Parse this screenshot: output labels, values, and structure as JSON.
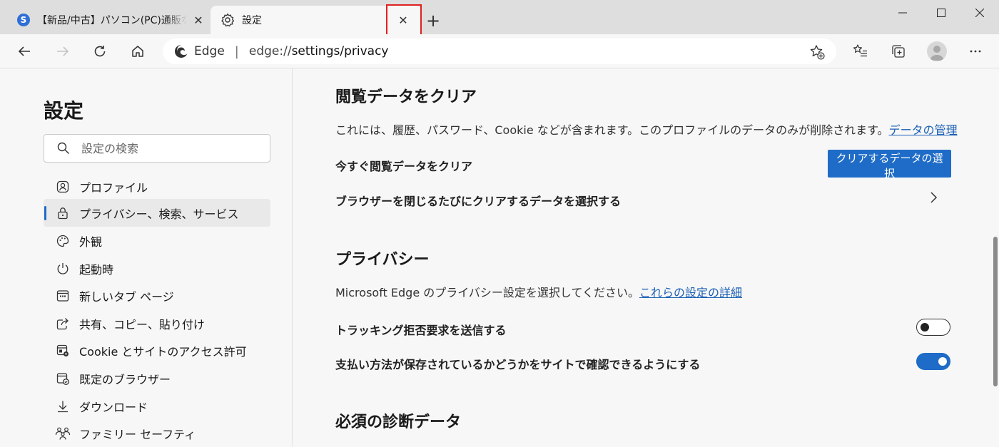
{
  "tabs": [
    {
      "title": "【新品/中古】パソコン(PC)通販ならソフマップ",
      "close": "✕"
    },
    {
      "title": "設定",
      "close": "✕"
    }
  ],
  "newtab": "+",
  "window_controls": {
    "minimize": "—",
    "maximize": "☐",
    "close": "✕"
  },
  "address": {
    "label": "Edge",
    "separator": "|",
    "url_prefix": "edge://",
    "url_rest": "settings/privacy"
  },
  "sidebar": {
    "title": "設定",
    "search_placeholder": "設定の検索",
    "items": [
      {
        "label": "プロファイル",
        "icon": "profile-icon"
      },
      {
        "label": "プライバシー、検索、サービス",
        "icon": "lock-icon",
        "active": true
      },
      {
        "label": "外観",
        "icon": "palette-icon"
      },
      {
        "label": "起動時",
        "icon": "power-icon"
      },
      {
        "label": "新しいタブ ページ",
        "icon": "newtab-page-icon"
      },
      {
        "label": "共有、コピー、貼り付け",
        "icon": "share-icon"
      },
      {
        "label": "Cookie とサイトのアクセス許可",
        "icon": "site-permissions-icon"
      },
      {
        "label": "既定のブラウザー",
        "icon": "default-browser-icon"
      },
      {
        "label": "ダウンロード",
        "icon": "download-icon"
      },
      {
        "label": "ファミリー セーフティ",
        "icon": "family-icon"
      }
    ]
  },
  "content": {
    "clear_section": {
      "title": "閲覧データをクリア",
      "description": "これには、履歴、パスワード、Cookie などが含まれます。このプロファイルのデータのみが削除されます。",
      "link": "データの管理",
      "clear_now_label": "今すぐ閲覧データをクリア",
      "clear_button": "クリアするデータの選択",
      "on_close_label": "ブラウザーを閉じるたびにクリアするデータを選択する"
    },
    "privacy_section": {
      "title": "プライバシー",
      "description": "Microsoft Edge のプライバシー設定を選択してください。",
      "link": "これらの設定の詳細",
      "dnt_label": "トラッキング拒否要求を送信する",
      "dnt_enabled": false,
      "payment_label": "支払い方法が保存されているかどうかをサイトで確認できるようにする",
      "payment_enabled": true
    },
    "diagnostic_section": {
      "title": "必須の診断データ"
    }
  },
  "colors": {
    "accent": "#1e6cc7",
    "highlight": "#e02020"
  }
}
